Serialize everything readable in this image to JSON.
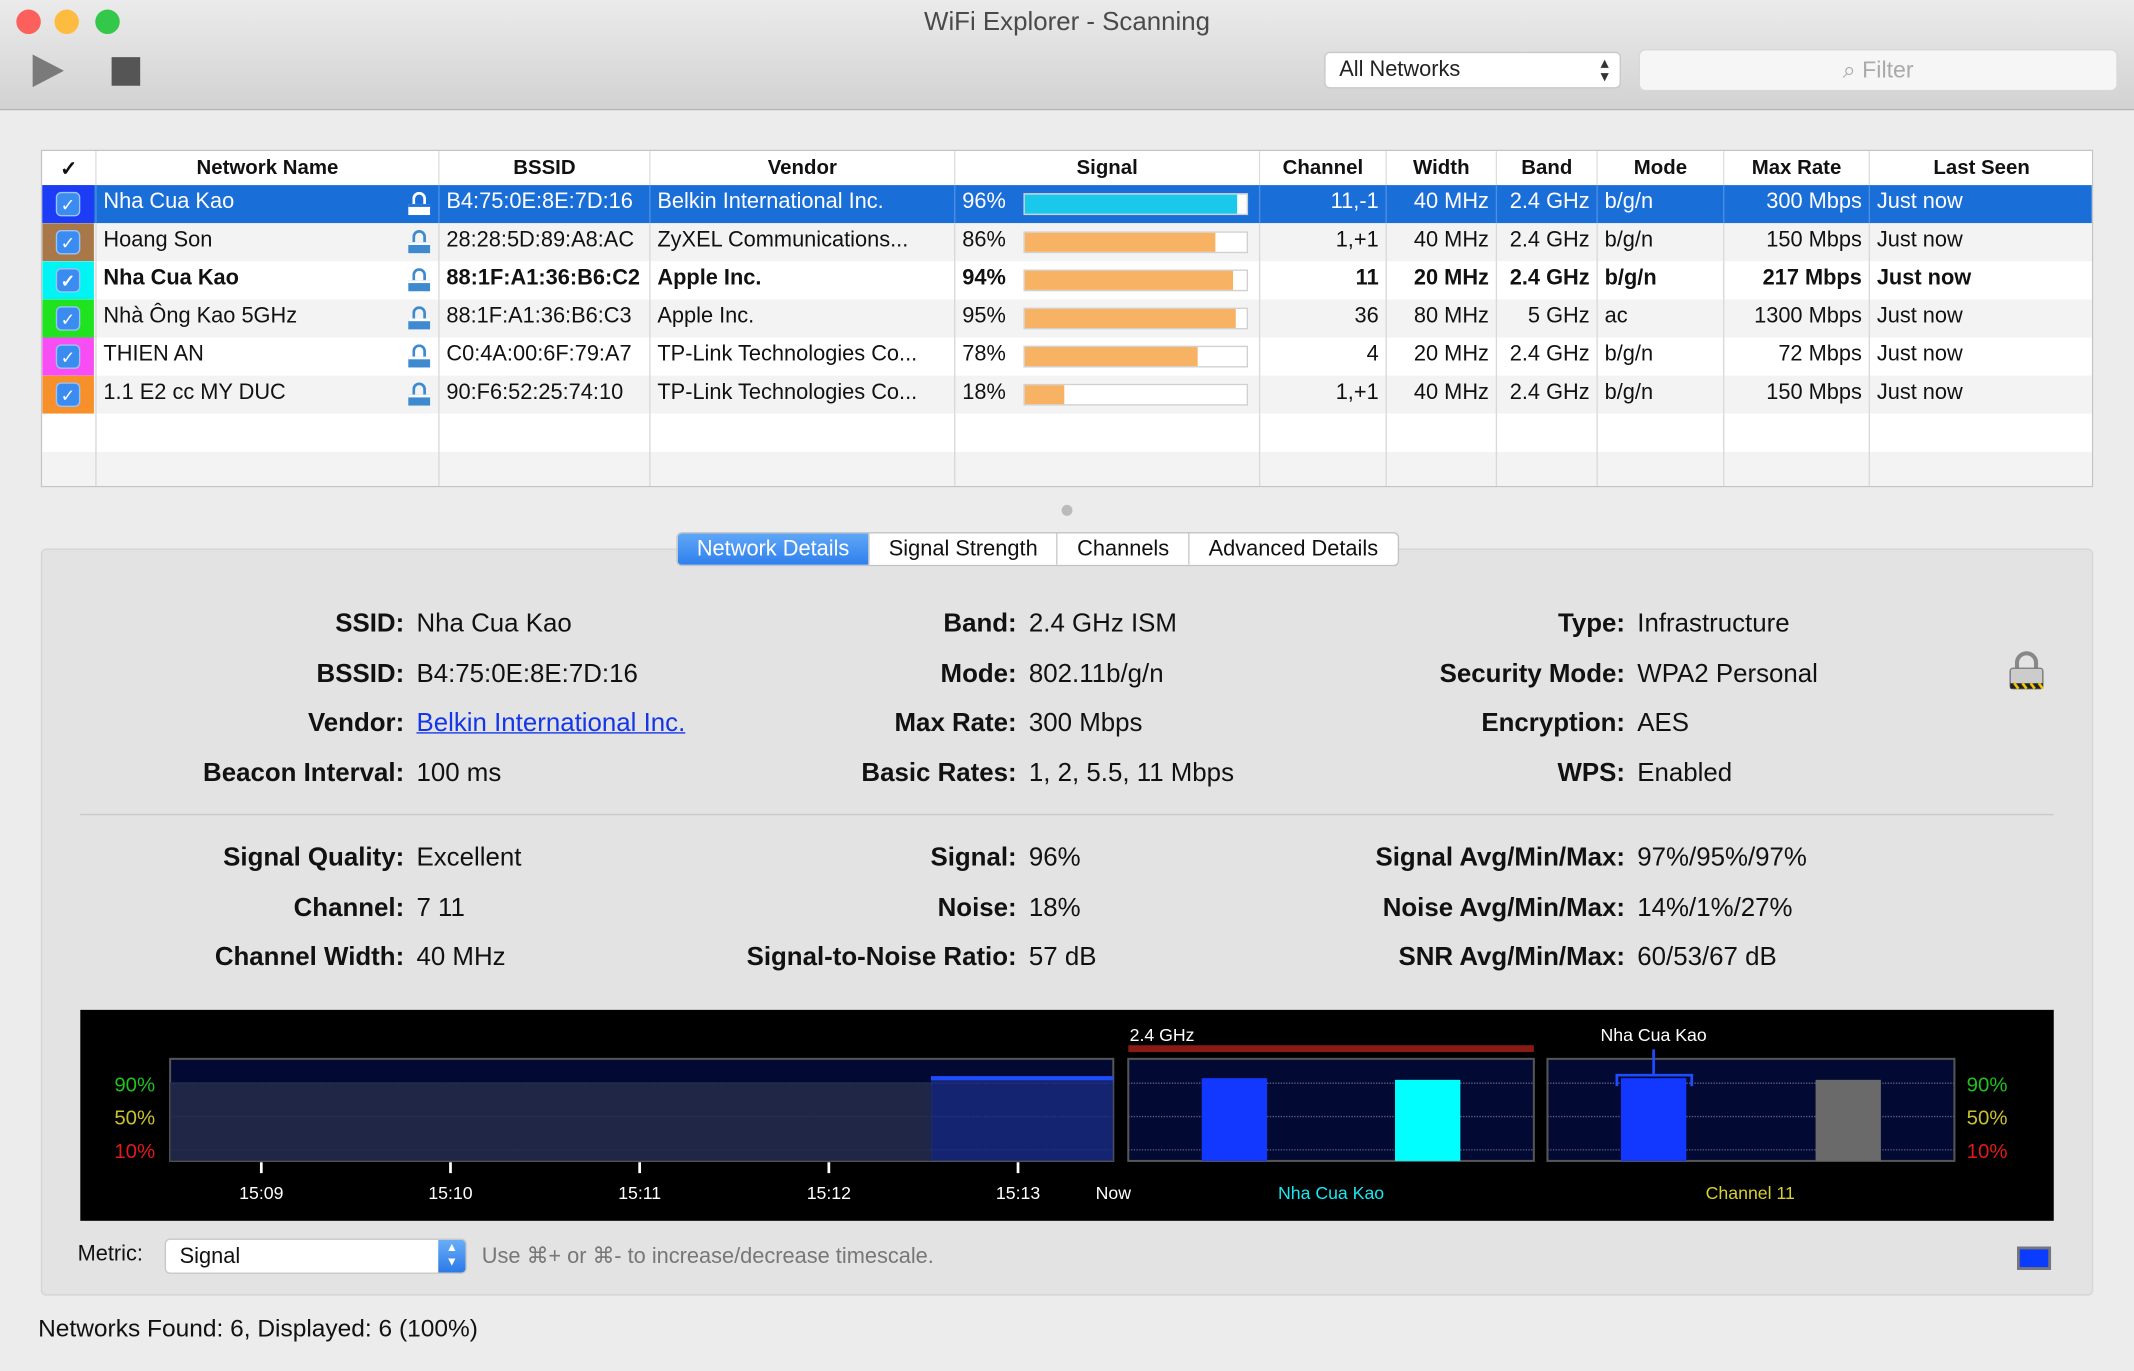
{
  "window": {
    "title": "WiFi Explorer - Scanning"
  },
  "toolbar": {
    "play": "play-icon",
    "stop": "stop-icon",
    "network_filter": "All Networks",
    "filter_placeholder": "Filter"
  },
  "table": {
    "headers": [
      "✓",
      "Network Name",
      "BSSID",
      "Vendor",
      "Signal",
      "Channel",
      "Width",
      "Band",
      "Mode",
      "Max Rate",
      "Last Seen"
    ],
    "rows": [
      {
        "color": "#1d3cf5",
        "checked": true,
        "name": "Nha Cua Kao",
        "bssid": "B4:75:0E:8E:7D:16",
        "vendor": "Belkin International Inc.",
        "signal": "96%",
        "signal_value": 96,
        "channel": "11,-1",
        "width": "40 MHz",
        "band": "2.4 GHz",
        "mode": "b/g/n",
        "max_rate": "300 Mbps",
        "last_seen": "Just now",
        "selected": true,
        "bold": false
      },
      {
        "color": "#a97848",
        "checked": true,
        "name": "Hoang Son",
        "bssid": "28:28:5D:89:A8:AC",
        "vendor": "ZyXEL Communications...",
        "signal": "86%",
        "signal_value": 86,
        "channel": "1,+1",
        "width": "40 MHz",
        "band": "2.4 GHz",
        "mode": "b/g/n",
        "max_rate": "150 Mbps",
        "last_seen": "Just now",
        "selected": false,
        "bold": false
      },
      {
        "color": "#00f4f4",
        "checked": true,
        "name": "Nha Cua Kao",
        "bssid": "88:1F:A1:36:B6:C2",
        "vendor": "Apple Inc.",
        "signal": "94%",
        "signal_value": 94,
        "channel": "11",
        "width": "20 MHz",
        "band": "2.4 GHz",
        "mode": "b/g/n",
        "max_rate": "217 Mbps",
        "last_seen": "Just now",
        "selected": false,
        "bold": true
      },
      {
        "color": "#1fe31f",
        "checked": true,
        "name": "Nhà Ông Kao 5GHz",
        "bssid": "88:1F:A1:36:B6:C3",
        "vendor": "Apple Inc.",
        "signal": "95%",
        "signal_value": 95,
        "channel": "36",
        "width": "80 MHz",
        "band": "5 GHz",
        "mode": "ac",
        "max_rate": "1300 Mbps",
        "last_seen": "Just now",
        "selected": false,
        "bold": false
      },
      {
        "color": "#f84cf4",
        "checked": true,
        "name": "THIEN AN",
        "bssid": "C0:4A:00:6F:79:A7",
        "vendor": "TP-Link Technologies Co...",
        "signal": "78%",
        "signal_value": 78,
        "channel": "4",
        "width": "20 MHz",
        "band": "2.4 GHz",
        "mode": "b/g/n",
        "max_rate": "72 Mbps",
        "last_seen": "Just now",
        "selected": false,
        "bold": false
      },
      {
        "color": "#f7902a",
        "checked": true,
        "name": "1.1 E2 cc MY DUC",
        "bssid": "90:F6:52:25:74:10",
        "vendor": "TP-Link Technologies Co...",
        "signal": "18%",
        "signal_value": 18,
        "channel": "1,+1",
        "width": "40 MHz",
        "band": "2.4 GHz",
        "mode": "b/g/n",
        "max_rate": "150 Mbps",
        "last_seen": "Just now",
        "selected": false,
        "bold": false
      }
    ]
  },
  "tabs": [
    "Network Details",
    "Signal Strength",
    "Channels",
    "Advanced Details"
  ],
  "details": {
    "col1": [
      [
        "SSID:",
        "Nha Cua Kao"
      ],
      [
        "BSSID:",
        "B4:75:0E:8E:7D:16"
      ],
      [
        "Vendor:",
        "Belkin International Inc."
      ],
      [
        "Beacon Interval:",
        "100 ms"
      ]
    ],
    "col2": [
      [
        "Band:",
        "2.4 GHz ISM"
      ],
      [
        "Mode:",
        "802.11b/g/n"
      ],
      [
        "Max Rate:",
        "300 Mbps"
      ],
      [
        "Basic Rates:",
        "1, 2, 5.5, 11 Mbps"
      ]
    ],
    "col3": [
      [
        "Type:",
        "Infrastructure"
      ],
      [
        "Security Mode:",
        "WPA2 Personal"
      ],
      [
        "Encryption:",
        "AES"
      ],
      [
        "WPS:",
        "Enabled"
      ]
    ],
    "col4": [
      [
        "Signal Quality:",
        "Excellent"
      ],
      [
        "Channel:",
        "7 11"
      ],
      [
        "Channel Width:",
        "40 MHz"
      ]
    ],
    "col5": [
      [
        "Signal:",
        "96%"
      ],
      [
        "Noise:",
        "18%"
      ],
      [
        "Signal-to-Noise Ratio:",
        "57 dB"
      ]
    ],
    "col6": [
      [
        "Signal Avg/Min/Max:",
        "97%/95%/97%"
      ],
      [
        "Noise Avg/Min/Max:",
        "14%/1%/27%"
      ],
      [
        "SNR Avg/Min/Max:",
        "60/53/67 dB"
      ]
    ]
  },
  "chart_data": {
    "type": "bar",
    "y_ticks": [
      "90%",
      "50%",
      "10%"
    ],
    "ylim": [
      0,
      100
    ],
    "history": {
      "x_ticks": [
        "15:09",
        "15:10",
        "15:11",
        "15:12",
        "15:13",
        "Now"
      ],
      "series_value": 96
    },
    "band_panel": {
      "title": "2.4 GHz",
      "label": "Nha Cua Kao",
      "values": [
        96,
        94
      ],
      "colors": [
        "#1238ff",
        "#00ffff"
      ]
    },
    "channel_panel": {
      "title": "Nha Cua Kao",
      "label": "Channel 11",
      "values": [
        96,
        94
      ],
      "colors": [
        "#1238ff",
        "#6a6a6a"
      ]
    }
  },
  "footer": {
    "metric_label": "Metric:",
    "metric_value": "Signal",
    "hint": "Use ⌘+ or ⌘- to increase/decrease timescale.",
    "series_color": "#0a3cff"
  },
  "status": "Networks Found: 6, Displayed: 6 (100%)"
}
